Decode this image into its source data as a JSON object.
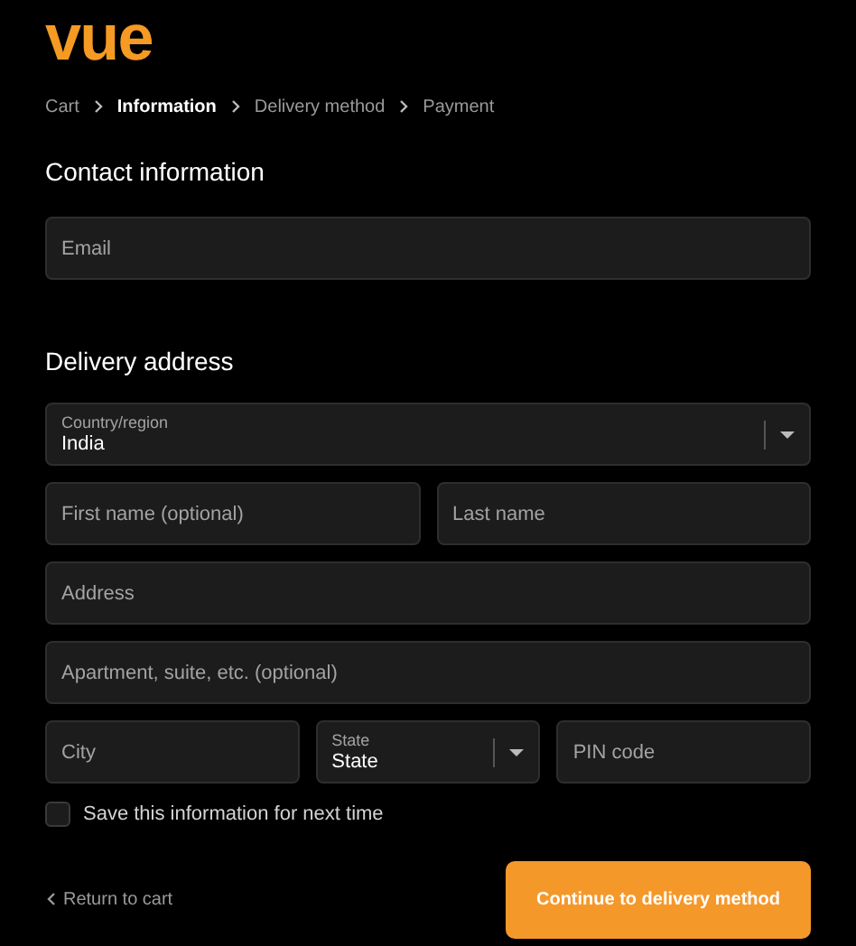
{
  "logo": "vue",
  "breadcrumb": [
    {
      "label": "Cart",
      "selected": false
    },
    {
      "label": "Information",
      "selected": true
    },
    {
      "label": "Delivery method",
      "selected": false
    },
    {
      "label": "Payment",
      "selected": false
    }
  ],
  "contact": {
    "heading": "Contact information",
    "fields": [
      {
        "kind": "text",
        "placeholder": "Email"
      }
    ]
  },
  "delivery": {
    "heading": "Delivery address",
    "rows": [
      [
        {
          "kind": "select",
          "label": "Country/region",
          "value": "India"
        }
      ],
      [
        {
          "kind": "text",
          "placeholder": "First name (optional)"
        },
        {
          "kind": "text",
          "placeholder": "Last name"
        }
      ],
      [
        {
          "kind": "text",
          "placeholder": "Address"
        }
      ],
      [
        {
          "kind": "text",
          "placeholder": "Apartment, suite, etc. (optional)"
        }
      ],
      [
        {
          "kind": "text",
          "placeholder": "City"
        },
        {
          "kind": "select",
          "label": "State",
          "value": "State"
        },
        {
          "kind": "text",
          "placeholder": "PIN code"
        }
      ]
    ]
  },
  "save_info": {
    "label": "Save this information for next time",
    "checked": false
  },
  "return_link": "Return to cart",
  "continue_button": "Continue to delivery method"
}
